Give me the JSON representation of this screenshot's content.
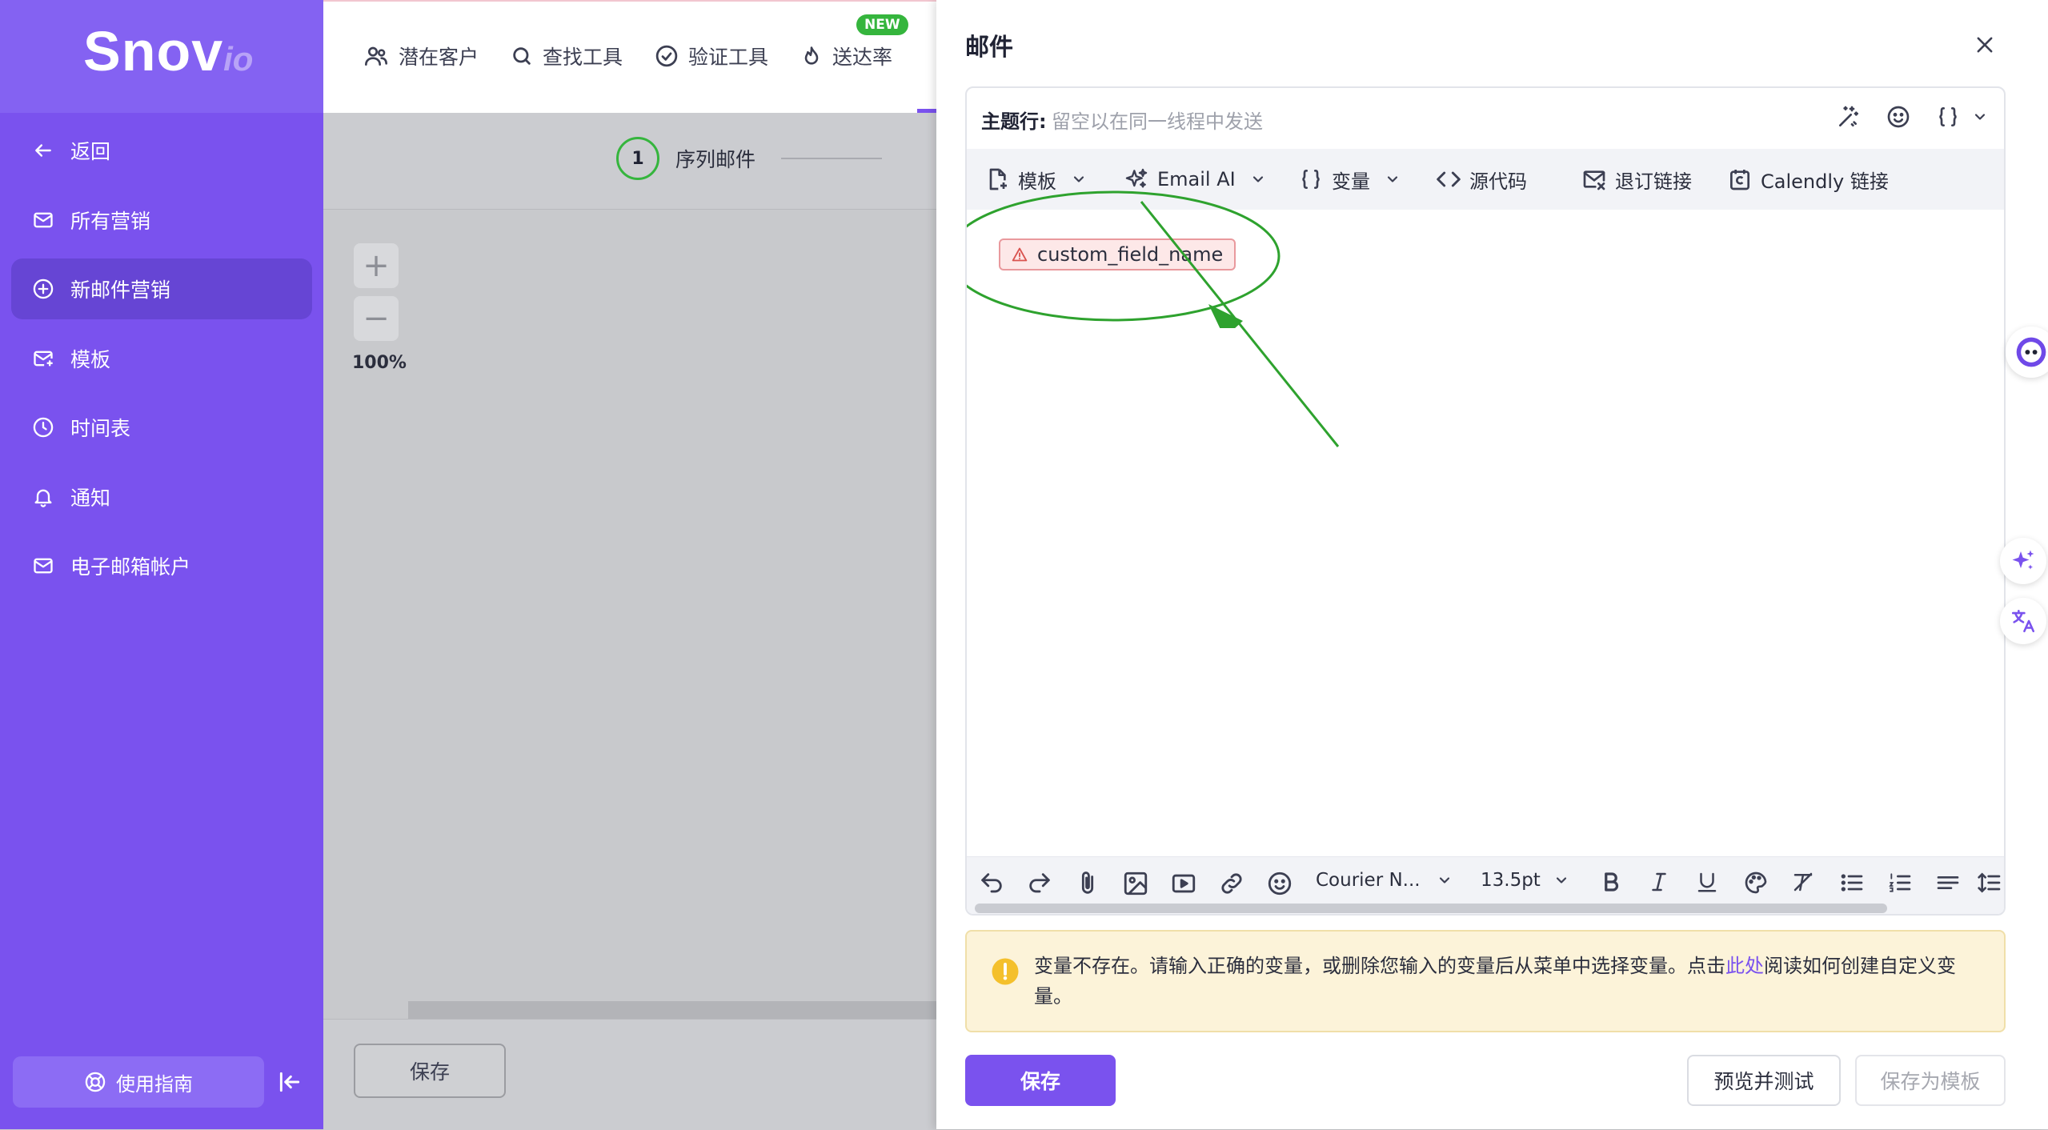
{
  "sidebar": {
    "logo_main": "Snov",
    "logo_sub": "io",
    "items": [
      {
        "label": "返回",
        "icon": "arrow-left-icon"
      },
      {
        "label": "所有营销",
        "icon": "mail-icon"
      },
      {
        "label": "新邮件营销",
        "icon": "plus-circle-icon",
        "active": true
      },
      {
        "label": "模板",
        "icon": "mail-template-icon"
      },
      {
        "label": "时间表",
        "icon": "clock-icon"
      },
      {
        "label": "通知",
        "icon": "bell-icon"
      },
      {
        "label": "电子邮箱帐户",
        "icon": "mail-account-icon"
      }
    ],
    "guide_label": "使用指南"
  },
  "topnav": {
    "items": [
      {
        "label": "潜在客户",
        "icon": "users-icon"
      },
      {
        "label": "查找工具",
        "icon": "search-icon"
      },
      {
        "label": "验证工具",
        "icon": "check-circle-icon"
      },
      {
        "label": "送达率",
        "icon": "flame-icon"
      }
    ],
    "badge": "NEW"
  },
  "canvas": {
    "step_number": "1",
    "step_label": "序列邮件",
    "zoom_in": "+",
    "zoom_out": "−",
    "zoom_level": "100%",
    "save_label": "保存"
  },
  "panel": {
    "title": "邮件",
    "subject_label": "主题行:",
    "subject_placeholder": "留空以在同一线程中发送",
    "toolbar": {
      "template": "模板",
      "email_ai": "Email AI",
      "variables": "变量",
      "source": "源代码",
      "unsubscribe": "退订链接",
      "calendly": "Calendly 链接"
    },
    "variable_tag": "custom_field_name",
    "format": {
      "font": "Courier N...",
      "size": "13.5pt"
    },
    "warning": {
      "text_before": "变量不存在。请输入正确的变量，或删除您输入的变量后从菜单中选择变量。点击",
      "link": "此处",
      "text_after": "阅读如何创建自定义变量。"
    },
    "save_label": "保存",
    "preview_label": "预览并测试",
    "save_template_label": "保存为模板"
  },
  "colors": {
    "brand": "#7a52ee",
    "annotation": "#2ea22e",
    "warning_bg": "#fcf3d9",
    "error_tag": "#fde8e8"
  }
}
